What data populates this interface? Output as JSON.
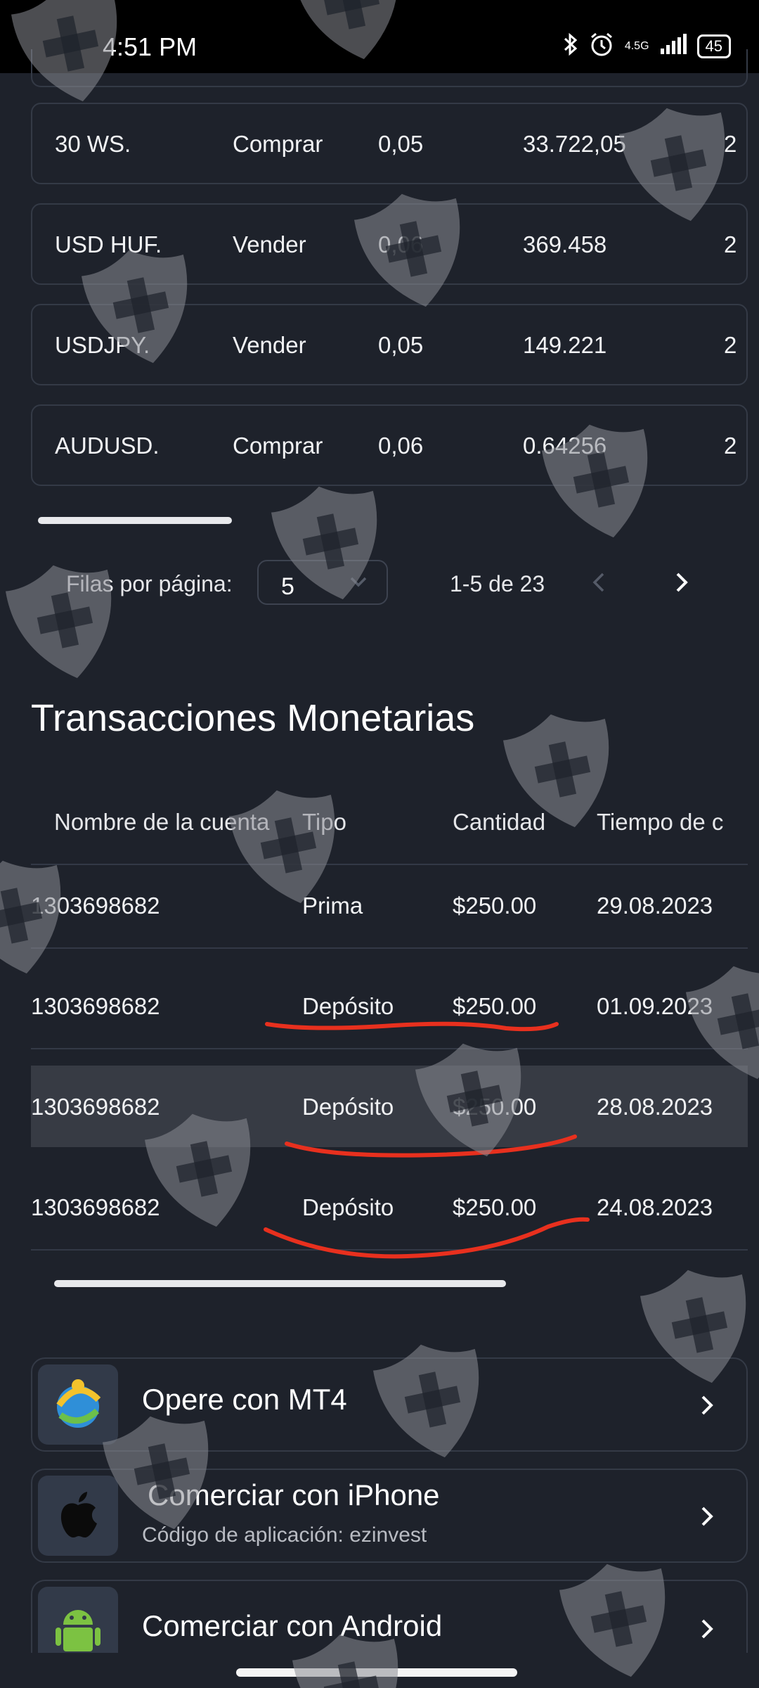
{
  "status_bar": {
    "time": "4:51 PM",
    "network": "4.5G",
    "battery": "45"
  },
  "trades": [
    {
      "symbol": "30 WS.",
      "type": "Comprar",
      "volume": "0,05",
      "price": "33.722,05",
      "extra": "2"
    },
    {
      "symbol": "USD HUF.",
      "type": "Vender",
      "volume": "0,06",
      "price": "369.458",
      "extra": "2"
    },
    {
      "symbol": "USDJPY.",
      "type": "Vender",
      "volume": "0,05",
      "price": "149.221",
      "extra": "2"
    },
    {
      "symbol": "AUDUSD.",
      "type": "Comprar",
      "volume": "0,06",
      "price": "0.64256",
      "extra": "2"
    }
  ],
  "pagination": {
    "label": "Filas por página:",
    "rows": "5",
    "range": "1-5 de 23"
  },
  "transactions": {
    "title": "Transacciones Monetarias",
    "headers": [
      "Nombre de la cuenta",
      "Tipo",
      "Cantidad",
      "Tiempo de c"
    ],
    "rows": [
      {
        "account": "1303698682",
        "type": "Prima",
        "amount": "$250.00",
        "time": "29.08.2023"
      },
      {
        "account": "1303698682",
        "type": "Depósito",
        "amount": "$250.00",
        "time": "01.09.2023"
      },
      {
        "account": "1303698682",
        "type": "Depósito",
        "amount": "$250.00",
        "time": "28.08.2023"
      },
      {
        "account": "1303698682",
        "type": "Depósito",
        "amount": "$250.00",
        "time": "24.08.2023"
      }
    ]
  },
  "apps": [
    {
      "title": "Opere con MT4",
      "subtitle": "",
      "icon": "mt4-logo-icon"
    },
    {
      "title": "Comerciar con iPhone",
      "subtitle": "Código de aplicación: ezinvest",
      "icon": "apple-logo-icon"
    },
    {
      "title": "Comerciar con Android",
      "subtitle": "",
      "icon": "android-logo-icon"
    }
  ],
  "colors": {
    "background": "#1e222b",
    "highlight_row": "#373b44",
    "annotation": "#e8301e",
    "watermark": "#8a8d93"
  }
}
